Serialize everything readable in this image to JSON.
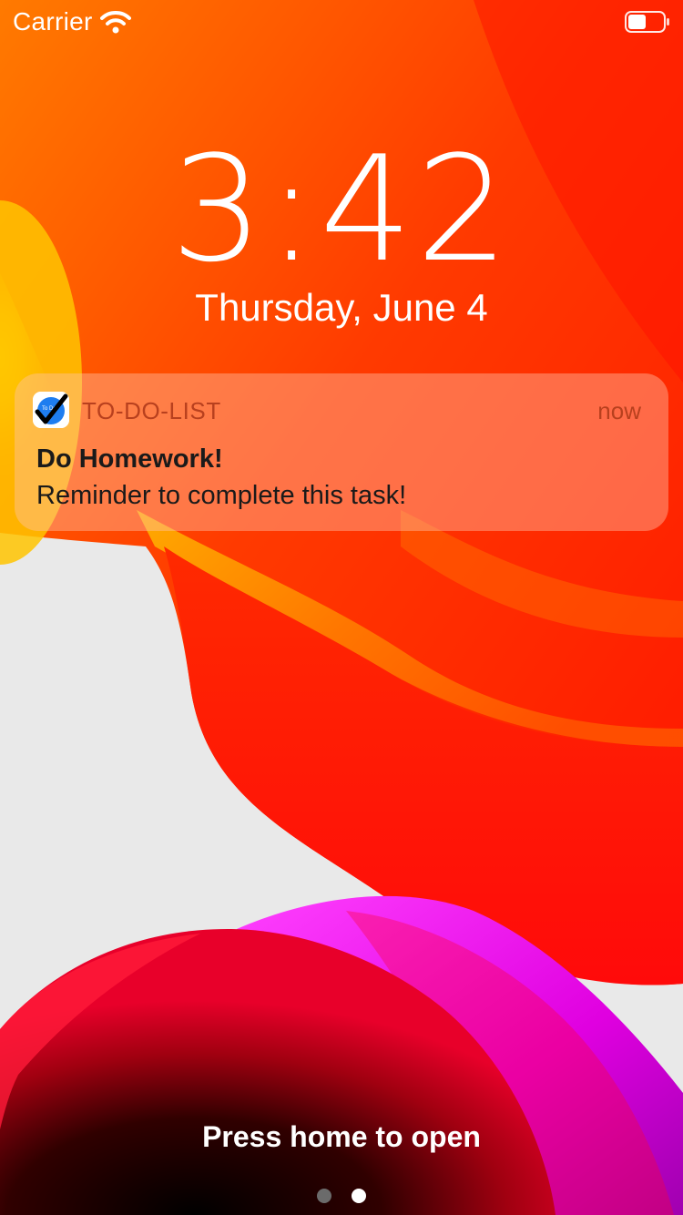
{
  "status_bar": {
    "carrier": "Carrier",
    "wifi_icon": "wifi-icon",
    "battery_icon": "battery-icon"
  },
  "lock_screen": {
    "time": "3:42",
    "date": "Thursday, June 4"
  },
  "notification": {
    "app_name": "TO-DO-LIST",
    "app_icon": "todo-app-icon",
    "app_icon_text": "To Do!",
    "time": "now",
    "title": "Do Homework!",
    "body": "Reminder to complete this task!"
  },
  "footer": {
    "press_home": "Press home to open",
    "page_dots": [
      {
        "name": "camera-page-dot",
        "active": false
      },
      {
        "name": "lock-page-dot",
        "active": true
      }
    ]
  },
  "colors": {
    "wallpaper_red": "#ff1a00",
    "wallpaper_orange": "#ff6a00",
    "wallpaper_yellow": "#ffc400",
    "wallpaper_magenta": "#ff28f0",
    "wallpaper_gray": "#e9e9e9",
    "notification_app_text": "#b8401e",
    "app_icon_blue": "#1e7df0",
    "dot_inactive": "#6b6b6b",
    "dot_active": "#ffffff"
  }
}
